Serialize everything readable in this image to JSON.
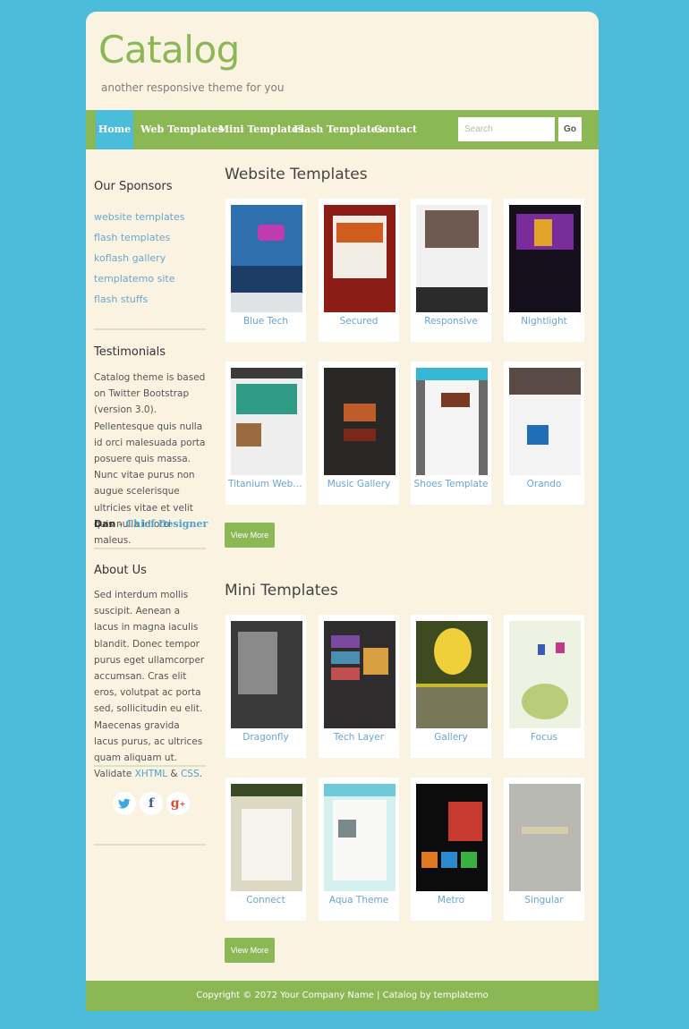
{
  "site": {
    "title": "Catalog",
    "tagline": "another responsive theme for you"
  },
  "nav": {
    "items": [
      "Home",
      "Web Templates",
      "Mini Templates",
      "Flash Templates",
      "Contact"
    ],
    "search_placeholder": "Search",
    "search_button": "Go"
  },
  "sidebar": {
    "sponsors_title": "Our Sponsors",
    "sponsors": [
      "website templates",
      "flash templates",
      "koflash gallery",
      "templatemo site",
      "flash stuffs"
    ],
    "testimonials_title": "Testimonials",
    "testimonial": "Catalog theme is based on Twitter Bootstrap (version 3.0). Pellentesque quis nulla id orci malesuada porta posuere quis massa. Nunc vitae purus non augue scelerisque ultricies vitae et velit quis nulla id orci maleus.",
    "testimonial_author": "Dan",
    "testimonial_sep": " - ",
    "testimonial_role": "Chief Designer",
    "about_title": "About Us",
    "about_text": "Sed interdum mollis suscipit. Aenean a lacus in magna iaculis blandit. Donec tempor purus eget ullamcorper accumsan. Cras elit eros, volutpat ac porta sed, sollicitudin eu elit. Maecenas gravida lacus purus, ac ultrices quam aliquam ut. Validate",
    "about_link_xhtml": "XHTML",
    "about_amp": " & ",
    "about_link_css": "CSS",
    "about_end": ".",
    "social": [
      "twitter-icon",
      "facebook-icon",
      "google-plus-icon"
    ]
  },
  "website_templates": {
    "title": "Website Templates",
    "items": [
      "Blue Tech",
      "Secured",
      "Responsive",
      "Nightlight",
      "Titanium Web Te...",
      "Music Gallery",
      "Shoes Template",
      "Orando"
    ],
    "button": "View More"
  },
  "mini_templates": {
    "title": "Mini Templates",
    "items": [
      "Dragonfly",
      "Tech Layer",
      "Gallery",
      "Focus",
      "Connect",
      "Aqua Theme",
      "Metro",
      "Singular"
    ],
    "button": "View More"
  },
  "footer": {
    "text": "Copyright © 2072 Your Company Name | Catalog by templatemo"
  },
  "colors": {
    "green": "#8bb755",
    "blue": "#4bbcd9",
    "cream": "#faf3e1",
    "link": "#6aa6cf"
  }
}
